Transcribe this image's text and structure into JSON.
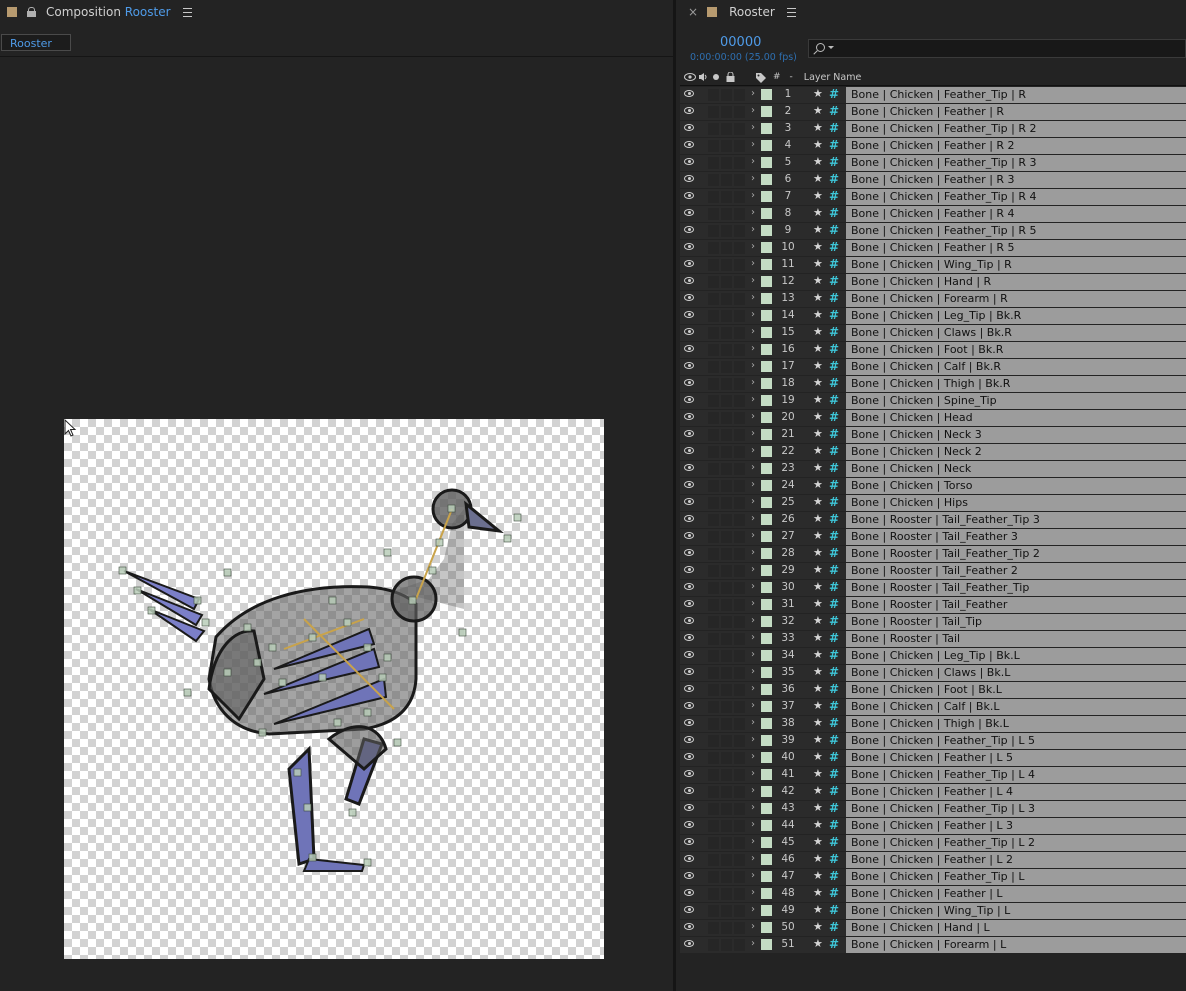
{
  "composition_panel": {
    "title_prefix": "Composition",
    "title_name": "Rooster",
    "tab_label": "Rooster",
    "icons": [
      "composition-swatch-icon",
      "lock-icon",
      "panel-menu-icon",
      "mouse-cursor-icon"
    ]
  },
  "timeline_panel": {
    "close_glyph": "×",
    "title": "Rooster",
    "timecode": "00000",
    "timecode_sub": "0:00:00:00 (25.00 fps)",
    "search_placeholder": "",
    "columns": {
      "eye_icon": "eye-icon",
      "audio_icon": "speaker-icon",
      "solo_icon": "solo-dot-icon",
      "lock_icon": "lock-icon",
      "label_icon": "label-tag-icon",
      "num": "#",
      "source_marker": "-",
      "layer_name": "Layer Name"
    },
    "accent_color": "#4f9be8",
    "layer_label_color": "#c4dcc4",
    "layer_type_color": "#3ec6d8",
    "layers": [
      {
        "num": "1",
        "name": "Bone | Chicken | Feather_Tip | R"
      },
      {
        "num": "2",
        "name": "Bone | Chicken | Feather | R"
      },
      {
        "num": "3",
        "name": "Bone | Chicken | Feather_Tip | R 2"
      },
      {
        "num": "4",
        "name": "Bone | Chicken | Feather | R 2"
      },
      {
        "num": "5",
        "name": "Bone | Chicken | Feather_Tip | R 3"
      },
      {
        "num": "6",
        "name": "Bone | Chicken | Feather | R 3"
      },
      {
        "num": "7",
        "name": "Bone | Chicken | Feather_Tip | R 4"
      },
      {
        "num": "8",
        "name": "Bone | Chicken | Feather | R 4"
      },
      {
        "num": "9",
        "name": "Bone | Chicken | Feather_Tip | R 5"
      },
      {
        "num": "10",
        "name": "Bone | Chicken | Feather | R 5"
      },
      {
        "num": "11",
        "name": "Bone | Chicken | Wing_Tip | R"
      },
      {
        "num": "12",
        "name": "Bone | Chicken | Hand | R"
      },
      {
        "num": "13",
        "name": "Bone | Chicken | Forearm | R"
      },
      {
        "num": "14",
        "name": "Bone | Chicken | Leg_Tip | Bk.R"
      },
      {
        "num": "15",
        "name": "Bone | Chicken | Claws | Bk.R"
      },
      {
        "num": "16",
        "name": "Bone | Chicken | Foot | Bk.R"
      },
      {
        "num": "17",
        "name": "Bone | Chicken | Calf | Bk.R"
      },
      {
        "num": "18",
        "name": "Bone | Chicken | Thigh | Bk.R"
      },
      {
        "num": "19",
        "name": "Bone | Chicken | Spine_Tip"
      },
      {
        "num": "20",
        "name": "Bone | Chicken | Head"
      },
      {
        "num": "21",
        "name": "Bone | Chicken | Neck 3"
      },
      {
        "num": "22",
        "name": "Bone | Chicken | Neck 2"
      },
      {
        "num": "23",
        "name": "Bone | Chicken | Neck"
      },
      {
        "num": "24",
        "name": "Bone | Chicken | Torso"
      },
      {
        "num": "25",
        "name": "Bone | Chicken | Hips"
      },
      {
        "num": "26",
        "name": "Bone | Rooster | Tail_Feather_Tip 3"
      },
      {
        "num": "27",
        "name": "Bone | Rooster | Tail_Feather 3"
      },
      {
        "num": "28",
        "name": "Bone | Rooster | Tail_Feather_Tip 2"
      },
      {
        "num": "29",
        "name": "Bone | Rooster | Tail_Feather 2"
      },
      {
        "num": "30",
        "name": "Bone | Rooster | Tail_Feather_Tip"
      },
      {
        "num": "31",
        "name": "Bone | Rooster | Tail_Feather"
      },
      {
        "num": "32",
        "name": "Bone | Rooster | Tail_Tip"
      },
      {
        "num": "33",
        "name": "Bone | Rooster | Tail"
      },
      {
        "num": "34",
        "name": "Bone | Chicken | Leg_Tip | Bk.L"
      },
      {
        "num": "35",
        "name": "Bone | Chicken | Claws | Bk.L"
      },
      {
        "num": "36",
        "name": "Bone | Chicken | Foot | Bk.L"
      },
      {
        "num": "37",
        "name": "Bone | Chicken | Calf | Bk.L"
      },
      {
        "num": "38",
        "name": "Bone | Chicken | Thigh | Bk.L"
      },
      {
        "num": "39",
        "name": "Bone | Chicken | Feather_Tip | L 5"
      },
      {
        "num": "40",
        "name": "Bone | Chicken | Feather | L 5"
      },
      {
        "num": "41",
        "name": "Bone | Chicken | Feather_Tip | L 4"
      },
      {
        "num": "42",
        "name": "Bone | Chicken | Feather | L 4"
      },
      {
        "num": "43",
        "name": "Bone | Chicken | Feather_Tip | L 3"
      },
      {
        "num": "44",
        "name": "Bone | Chicken | Feather | L 3"
      },
      {
        "num": "45",
        "name": "Bone | Chicken | Feather_Tip | L 2"
      },
      {
        "num": "46",
        "name": "Bone | Chicken | Feather | L 2"
      },
      {
        "num": "47",
        "name": "Bone | Chicken | Feather_Tip | L"
      },
      {
        "num": "48",
        "name": "Bone | Chicken | Feather | L"
      },
      {
        "num": "49",
        "name": "Bone | Chicken | Wing_Tip | L"
      },
      {
        "num": "50",
        "name": "Bone | Chicken | Hand | L"
      },
      {
        "num": "51",
        "name": "Bone | Chicken | Forearm | L"
      }
    ]
  }
}
